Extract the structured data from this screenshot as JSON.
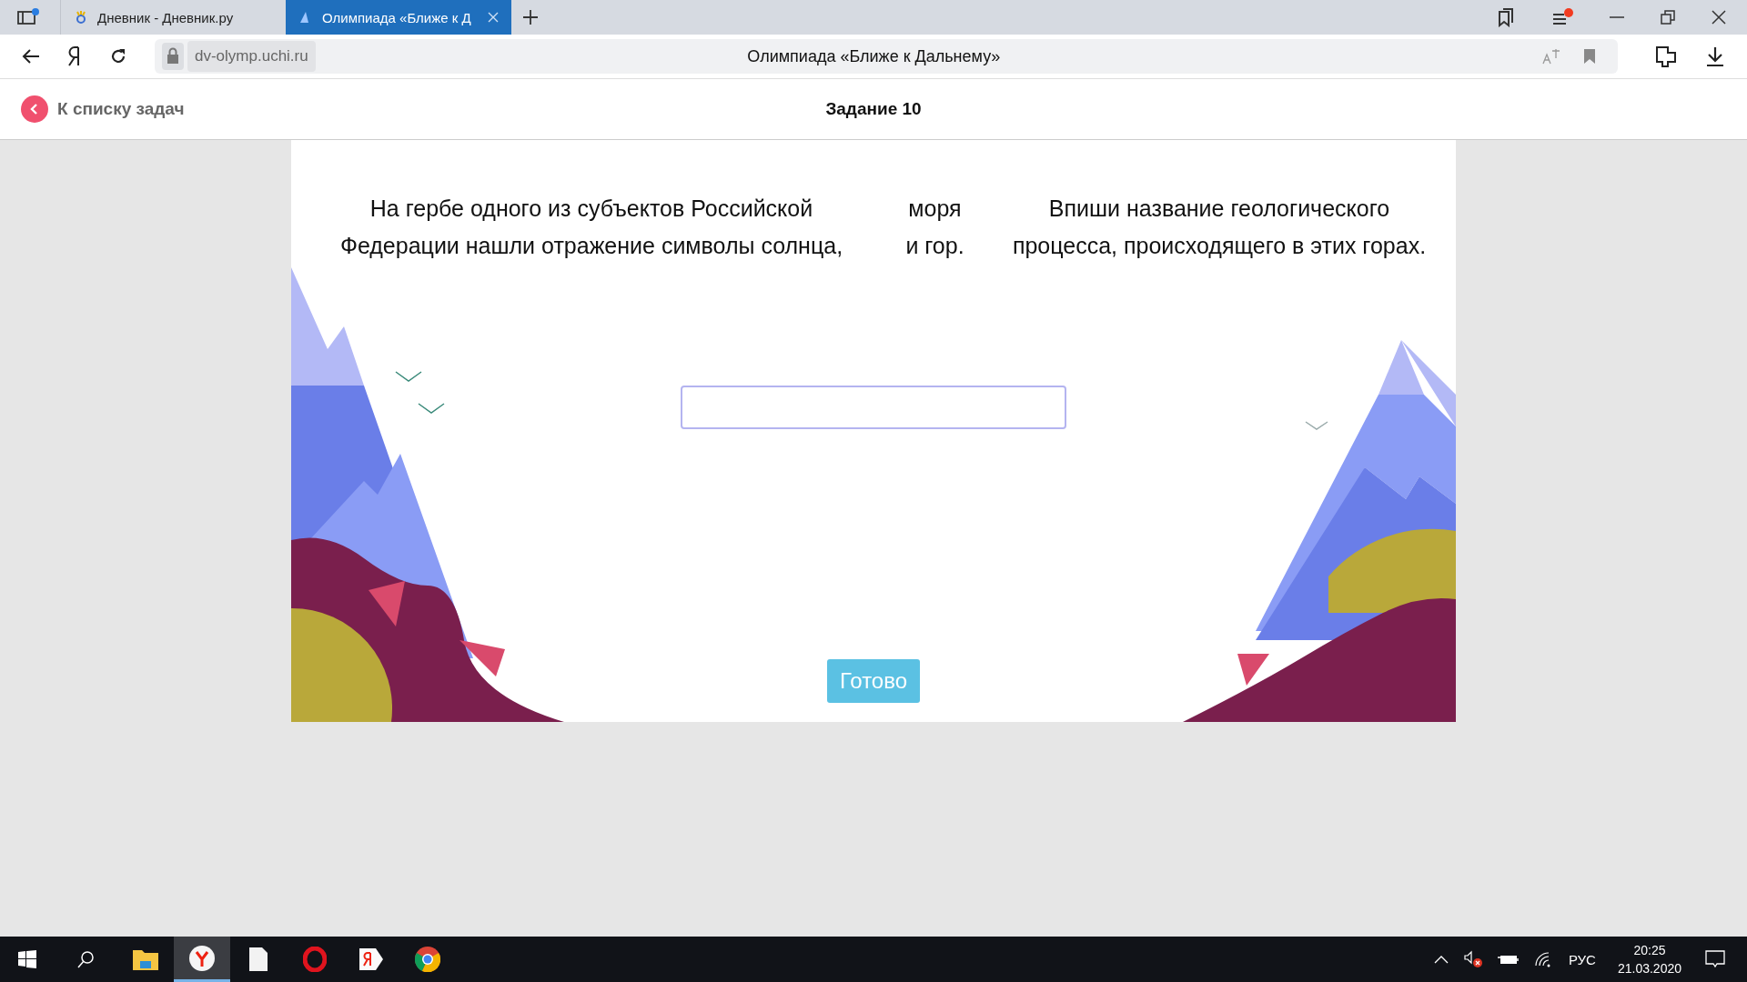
{
  "browser": {
    "tabs": [
      {
        "title": "Дневник - Дневник.ру",
        "selected": false
      },
      {
        "title": "Олимпиада «Ближе к Д",
        "selected": true
      }
    ],
    "address": {
      "domain": "dv-olymp.uchi.ru",
      "page_title": "Олимпиада «Ближе к Дальнему»"
    }
  },
  "header": {
    "back_link": "К списку задач",
    "title": "Задание 10"
  },
  "task": {
    "columns": [
      [
        "На гербе одного из субъектов Российской",
        "Федерации нашли отражение символы солнца,"
      ],
      [
        "моря",
        "и гор."
      ],
      [
        "Впиши название геологического",
        "процесса, происходящего в этих горах."
      ]
    ],
    "submit": "Готово"
  },
  "taskbar": {
    "apps": [
      {
        "kind": "explorer",
        "selected": false
      },
      {
        "kind": "yandex",
        "selected": true
      },
      {
        "kind": "notepad",
        "selected": false
      },
      {
        "kind": "opera",
        "selected": false
      },
      {
        "kind": "yandex-alt",
        "selected": false
      },
      {
        "kind": "chrome",
        "selected": false
      }
    ],
    "language": "РУС",
    "time": "20:25",
    "date": "21.03.2020"
  }
}
